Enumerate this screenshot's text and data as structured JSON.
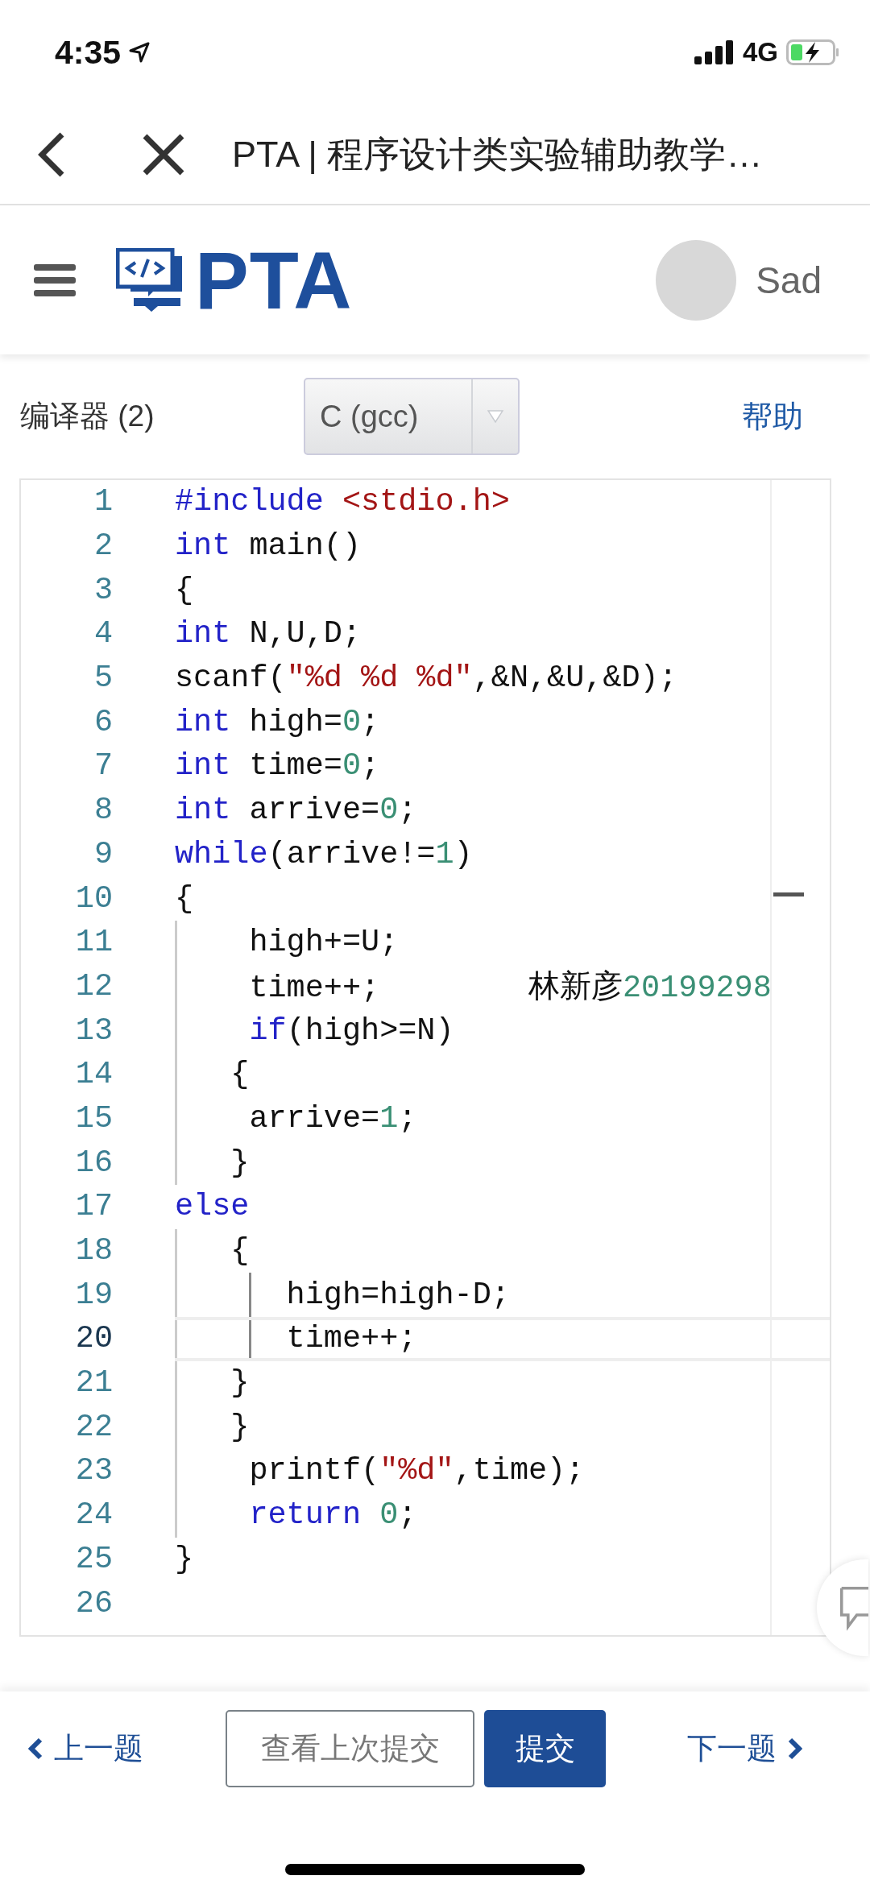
{
  "status_bar": {
    "time": "4:35",
    "network": "4G"
  },
  "browser_bar": {
    "title": "PTA | 程序设计类实验辅助教学…"
  },
  "header": {
    "logo": "PTA",
    "user": "Sad"
  },
  "compiler": {
    "label": "编译器 (2)",
    "value": "C (gcc)",
    "help": "帮助"
  },
  "editor": {
    "lines": [
      {
        "number": "1",
        "active": false,
        "tokens": [
          {
            "kind": "keyword",
            "text": "#include"
          },
          {
            "kind": "string",
            "text": " <stdio.h>"
          }
        ]
      },
      {
        "number": "2",
        "active": false,
        "tokens": [
          {
            "kind": "keyword",
            "text": "int"
          },
          {
            "kind": "plain",
            "text": " main()"
          }
        ]
      },
      {
        "number": "3",
        "active": false,
        "tokens": [
          {
            "kind": "plain",
            "text": "{"
          }
        ]
      },
      {
        "number": "4",
        "active": false,
        "tokens": [
          {
            "kind": "keyword",
            "text": "int"
          },
          {
            "kind": "plain",
            "text": " N,U,D;"
          }
        ]
      },
      {
        "number": "5",
        "active": false,
        "tokens": [
          {
            "kind": "plain",
            "text": "scanf("
          },
          {
            "kind": "string",
            "text": "\"%d %d %d\""
          },
          {
            "kind": "plain",
            "text": ",&N,&U,&D);"
          }
        ]
      },
      {
        "number": "6",
        "active": false,
        "tokens": [
          {
            "kind": "keyword",
            "text": "int"
          },
          {
            "kind": "plain",
            "text": " high="
          },
          {
            "kind": "number",
            "text": "0"
          },
          {
            "kind": "plain",
            "text": ";"
          }
        ]
      },
      {
        "number": "7",
        "active": false,
        "tokens": [
          {
            "kind": "keyword",
            "text": "int"
          },
          {
            "kind": "plain",
            "text": " time="
          },
          {
            "kind": "number",
            "text": "0"
          },
          {
            "kind": "plain",
            "text": ";"
          }
        ]
      },
      {
        "number": "8",
        "active": false,
        "tokens": [
          {
            "kind": "keyword",
            "text": "int"
          },
          {
            "kind": "plain",
            "text": " arrive="
          },
          {
            "kind": "number",
            "text": "0"
          },
          {
            "kind": "plain",
            "text": ";"
          }
        ]
      },
      {
        "number": "9",
        "active": false,
        "tokens": [
          {
            "kind": "keyword",
            "text": "while"
          },
          {
            "kind": "plain",
            "text": "(arrive!="
          },
          {
            "kind": "number",
            "text": "1"
          },
          {
            "kind": "plain",
            "text": ")"
          }
        ]
      },
      {
        "number": "10",
        "active": false,
        "tokens": [
          {
            "kind": "plain",
            "text": "{"
          }
        ]
      },
      {
        "number": "11",
        "active": false,
        "tokens": [
          {
            "kind": "plain",
            "text": "    high+=U;"
          }
        ]
      },
      {
        "number": "12",
        "active": false,
        "tokens": [
          {
            "kind": "plain",
            "text": "    time++;        林新彦"
          },
          {
            "kind": "number",
            "text": "20199298"
          }
        ]
      },
      {
        "number": "13",
        "active": false,
        "tokens": [
          {
            "kind": "keyword",
            "text": "    if"
          },
          {
            "kind": "plain",
            "text": "(high>=N)"
          }
        ]
      },
      {
        "number": "14",
        "active": false,
        "tokens": [
          {
            "kind": "plain",
            "text": "   {"
          }
        ]
      },
      {
        "number": "15",
        "active": false,
        "tokens": [
          {
            "kind": "plain",
            "text": "    arrive="
          },
          {
            "kind": "number",
            "text": "1"
          },
          {
            "kind": "plain",
            "text": ";"
          }
        ]
      },
      {
        "number": "16",
        "active": false,
        "tokens": [
          {
            "kind": "plain",
            "text": "   }"
          }
        ]
      },
      {
        "number": "17",
        "active": false,
        "tokens": [
          {
            "kind": "keyword",
            "text": "else"
          }
        ]
      },
      {
        "number": "18",
        "active": false,
        "tokens": [
          {
            "kind": "plain",
            "text": "   {"
          }
        ]
      },
      {
        "number": "19",
        "active": false,
        "tokens": [
          {
            "kind": "plain",
            "text": "      high=high-D;"
          }
        ]
      },
      {
        "number": "20",
        "active": true,
        "tokens": [
          {
            "kind": "plain",
            "text": "      time++;"
          }
        ]
      },
      {
        "number": "21",
        "active": false,
        "tokens": [
          {
            "kind": "plain",
            "text": "   }"
          }
        ]
      },
      {
        "number": "22",
        "active": false,
        "tokens": [
          {
            "kind": "plain",
            "text": "   }"
          }
        ]
      },
      {
        "number": "23",
        "active": false,
        "tokens": [
          {
            "kind": "plain",
            "text": "    printf("
          },
          {
            "kind": "string",
            "text": "\"%d\""
          },
          {
            "kind": "plain",
            "text": ",time);"
          }
        ]
      },
      {
        "number": "24",
        "active": false,
        "tokens": [
          {
            "kind": "keyword",
            "text": "    return"
          },
          {
            "kind": "number",
            "text": " 0"
          },
          {
            "kind": "plain",
            "text": ";"
          }
        ]
      },
      {
        "number": "25",
        "active": false,
        "tokens": [
          {
            "kind": "plain",
            "text": "}"
          }
        ]
      },
      {
        "number": "26",
        "active": false
      }
    ]
  },
  "footer": {
    "prev": "上一题",
    "history": "查看上次提交",
    "submit": "提交",
    "next": "下一题"
  }
}
